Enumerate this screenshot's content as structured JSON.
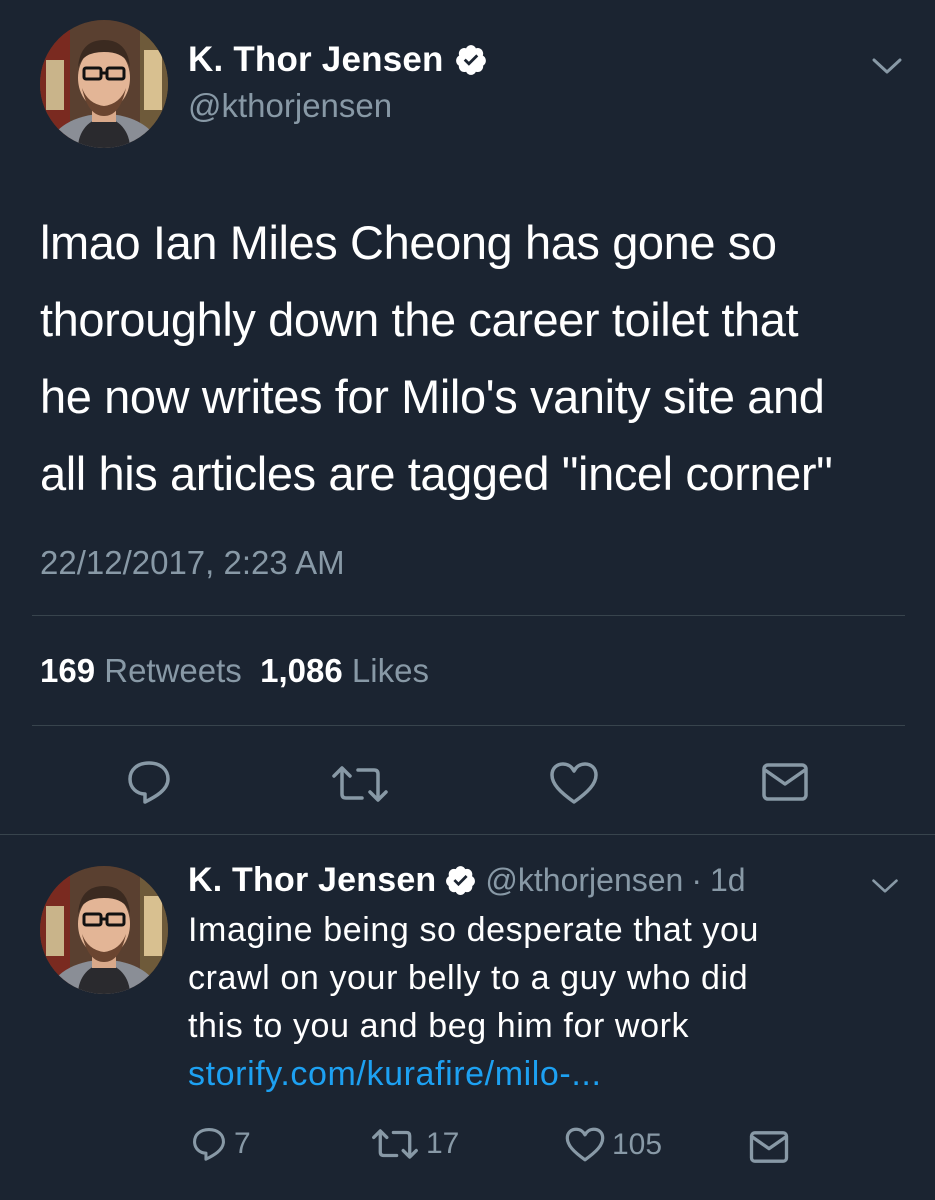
{
  "main_tweet": {
    "author": {
      "display_name": "K. Thor Jensen",
      "handle": "@kthorjensen",
      "verified": true
    },
    "text_lines": [
      "lmao Ian Miles Cheong has gone so",
      "thoroughly down the career toilet that",
      "he now writes for Milo's vanity site and",
      "all his articles are tagged \"incel corner\""
    ],
    "timestamp": "22/12/2017, 2:23 AM",
    "stats": {
      "retweets_count": "169",
      "retweets_label": "Retweets",
      "likes_count": "1,086",
      "likes_label": "Likes"
    },
    "actions": [
      "reply-icon",
      "retweet-icon",
      "like-icon",
      "message-icon"
    ]
  },
  "reply_tweet": {
    "author": {
      "display_name": "K. Thor Jensen",
      "handle": "@kthorjensen",
      "separator": "·",
      "age": "1d",
      "verified": true
    },
    "text_lines": [
      "Imagine being so desperate that you",
      "crawl on your belly to a guy who did",
      "this to you and beg him for work"
    ],
    "link": "storify.com/kurafire/milo-...",
    "counts": {
      "replies": "7",
      "retweets": "17",
      "likes": "105"
    }
  },
  "colors": {
    "background": "#1b2431",
    "text_primary": "#ffffff",
    "text_secondary": "#8899a6",
    "link": "#1da1f2",
    "divider": "#38444d"
  }
}
